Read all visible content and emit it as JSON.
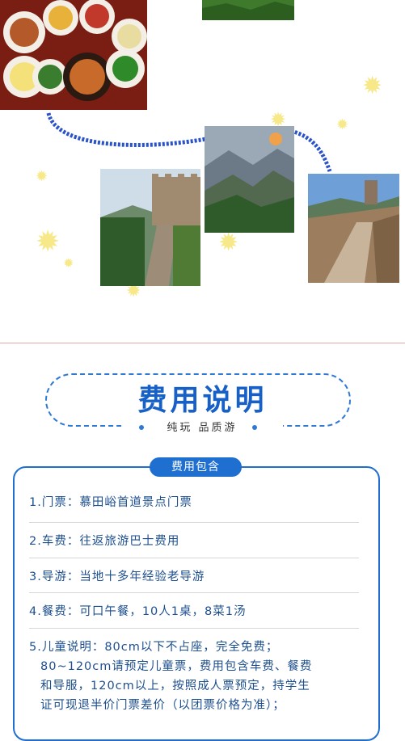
{
  "fee_section": {
    "title": "费用说明",
    "subtitle": "纯玩 品质游",
    "badge": "费用包含",
    "items": [
      "1.门票：慕田峪首道景点门票",
      "2.车费：往返旅游巴士费用",
      "3.导游：当地十多年经验老导游",
      "4.餐费：可口午餐，10人1桌，8菜1汤"
    ],
    "item5": {
      "line1": "5.儿童说明：80cm以下不占座，完全免费；",
      "line2": "80~120cm请预定儿童票，费用包含车费、餐费",
      "line3": "和导服，120cm以上，按照成人票预定，持学生",
      "line4": "证可现退半价门票差价（以团票价格为准）；"
    }
  },
  "colors": {
    "primary_blue": "#1f6fd1",
    "title_blue": "#1760c7",
    "item_text": "#1d4f8f",
    "sparkle_yellow": "#f7e98a",
    "divider_pink": "#e8a6a6"
  },
  "photos": [
    "food-photo",
    "mountain-top-photo",
    "great-wall-tower-photo",
    "misty-mountain-photo",
    "great-wall-walkway-photo"
  ]
}
